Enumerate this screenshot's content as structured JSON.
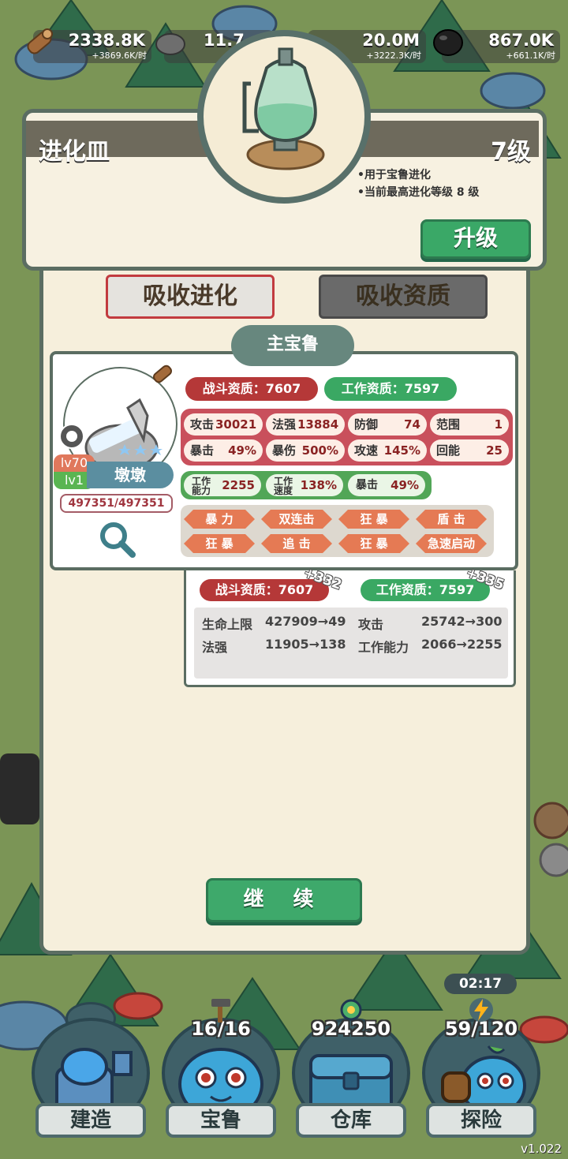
{
  "resources": [
    {
      "icon": "wood-icon",
      "amount": "2338.8K",
      "rate": "+3869.6K/时"
    },
    {
      "icon": "stone-icon",
      "amount": "11.7",
      "rate": ""
    },
    {
      "icon": "crystal-icon",
      "amount": "20.0M",
      "rate": "+3222.3K/时"
    },
    {
      "icon": "coal-icon",
      "amount": "867.0K",
      "rate": "+661.1K/时"
    }
  ],
  "item": {
    "title": "进化皿",
    "level": "7级",
    "desc1": "•用于宝鲁进化",
    "desc2": "•当前最高进化等级 8 级",
    "upgrade_label": "升级"
  },
  "tabs": {
    "absorb_evolution": "吸收进化",
    "absorb_aptitude": "吸收资质"
  },
  "beast": {
    "header": "主宝鲁",
    "lv_combat": "lv70",
    "lv_work": "lv1",
    "name": "墩墩",
    "hp": "497351/497351",
    "combat_apt": "战斗资质：7607",
    "work_apt": "工作资质：7597",
    "stats": [
      {
        "k": "攻击",
        "v": "30021"
      },
      {
        "k": "法强",
        "v": "13884"
      },
      {
        "k": "防御",
        "v": "74"
      },
      {
        "k": "范围",
        "v": "1"
      },
      {
        "k": "暴击",
        "v": "49%"
      },
      {
        "k": "暴伤",
        "v": "500%"
      },
      {
        "k": "攻速",
        "v": "145%"
      },
      {
        "k": "回能",
        "v": "25"
      }
    ],
    "work_stats": [
      {
        "k": "工作能力",
        "v": "2255"
      },
      {
        "k": "工作速度",
        "v": "138%"
      },
      {
        "k": "暴击",
        "v": "49%"
      }
    ],
    "skills": [
      "暴 力",
      "双连击",
      "狂 暴",
      "盾 击",
      "狂 暴",
      "追 击",
      "狂 暴",
      "急速启动"
    ]
  },
  "result": {
    "combat_apt": "战斗资质：7607",
    "work_apt": "工作资质：7597",
    "combat_plus": "+332",
    "work_plus": "+335",
    "gains": [
      {
        "k": "生命上限",
        "v": "427909→49"
      },
      {
        "k": "攻击",
        "v": "25742→300"
      },
      {
        "k": "法强",
        "v": "11905→138"
      },
      {
        "k": "工作能力",
        "v": "2066→2255"
      }
    ]
  },
  "continue_label": "继 续",
  "nav": [
    {
      "label": "建造",
      "count": ""
    },
    {
      "label": "宝鲁",
      "count": "16/16"
    },
    {
      "label": "仓库",
      "count": "924250"
    },
    {
      "label": "探险",
      "count": "59/120"
    }
  ],
  "timer": "02:17",
  "version": "v1.022",
  "colors": {
    "accent_green": "#3aa867",
    "panel_border": "#5b6d62",
    "combat_red": "#b53838"
  }
}
